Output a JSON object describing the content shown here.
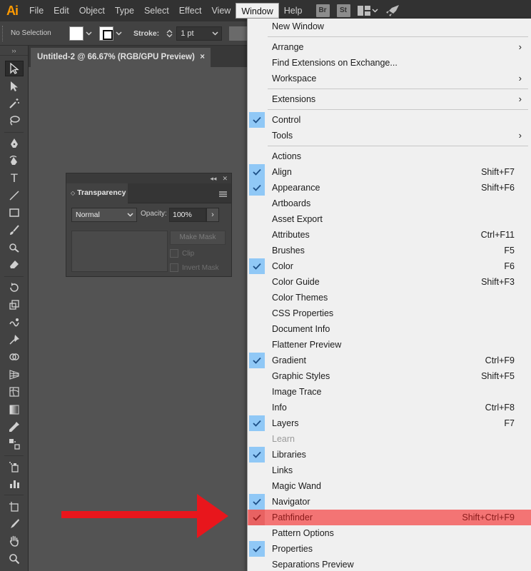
{
  "menubar": {
    "logo": "Ai",
    "items": [
      "File",
      "Edit",
      "Object",
      "Type",
      "Select",
      "Effect",
      "View",
      "Window",
      "Help"
    ],
    "active_item": "Window",
    "badges": [
      "Br",
      "St"
    ],
    "icons": [
      "arrange-documents-icon",
      "chevron-down-icon",
      "gpu-performance-rocket-icon"
    ]
  },
  "controlbar": {
    "selection": "No Selection",
    "stroke_label": "Stroke:",
    "stroke_value": "1 pt"
  },
  "document_tab": {
    "title": "Untitled-2 @ 66.67% (RGB/GPU Preview)",
    "close": "×"
  },
  "transparency_panel": {
    "tab_label": "Transparency",
    "blend_mode": "Normal",
    "opacity_label": "Opacity:",
    "opacity_value": "100%",
    "make_mask": "Make Mask",
    "clip": "Clip",
    "invert_mask": "Invert Mask"
  },
  "window_menu": {
    "items": [
      {
        "label": "New Window"
      },
      {
        "label": "Arrange",
        "submenu": true
      },
      {
        "label": "Find Extensions on Exchange..."
      },
      {
        "label": "Workspace",
        "submenu": true
      },
      {
        "label": "Extensions",
        "submenu": true
      },
      {
        "label": "Control",
        "checked": true
      },
      {
        "label": "Tools",
        "submenu": true
      },
      {
        "label": "Actions"
      },
      {
        "label": "Align",
        "checked": true,
        "shortcut": "Shift+F7"
      },
      {
        "label": "Appearance",
        "checked": true,
        "shortcut": "Shift+F6"
      },
      {
        "label": "Artboards"
      },
      {
        "label": "Asset Export"
      },
      {
        "label": "Attributes",
        "shortcut": "Ctrl+F11"
      },
      {
        "label": "Brushes",
        "shortcut": "F5"
      },
      {
        "label": "Color",
        "checked": true,
        "shortcut": "F6"
      },
      {
        "label": "Color Guide",
        "shortcut": "Shift+F3"
      },
      {
        "label": "Color Themes"
      },
      {
        "label": "CSS Properties"
      },
      {
        "label": "Document Info"
      },
      {
        "label": "Flattener Preview"
      },
      {
        "label": "Gradient",
        "checked": true,
        "shortcut": "Ctrl+F9"
      },
      {
        "label": "Graphic Styles",
        "shortcut": "Shift+F5"
      },
      {
        "label": "Image Trace"
      },
      {
        "label": "Info",
        "shortcut": "Ctrl+F8"
      },
      {
        "label": "Layers",
        "checked": true,
        "shortcut": "F7"
      },
      {
        "label": "Learn",
        "disabled": true
      },
      {
        "label": "Libraries",
        "checked": true
      },
      {
        "label": "Links"
      },
      {
        "label": "Magic Wand"
      },
      {
        "label": "Navigator",
        "checked": true
      },
      {
        "label": "Pathfinder",
        "checked": true,
        "shortcut": "Shift+Ctrl+F9",
        "highlighted": true
      },
      {
        "label": "Pattern Options"
      },
      {
        "label": "Properties",
        "checked": true
      },
      {
        "label": "Separations Preview"
      }
    ]
  },
  "colors": {
    "highlight": "#f37474",
    "check_bg": "#90c8f6",
    "arrow": "#e8161c",
    "logo": "#ff9a00"
  }
}
